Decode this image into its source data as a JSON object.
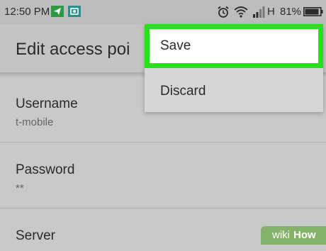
{
  "status_bar": {
    "time": "12:50 PM",
    "signal_label": "H",
    "battery": "81%",
    "icons": [
      "navigation-icon",
      "screenshot-icon",
      "alarm-icon",
      "wifi-icon",
      "signal-icon",
      "battery-icon"
    ]
  },
  "app_bar": {
    "title": "Edit access poi"
  },
  "prefs": [
    {
      "title": "Username",
      "summary": "t-mobile"
    },
    {
      "title": "Password",
      "summary": "**"
    },
    {
      "title": "Server",
      "summary": ""
    }
  ],
  "menu": {
    "save_label": "Save",
    "discard_label": "Discard"
  },
  "watermark": {
    "wiki": "wiki",
    "how": "How"
  },
  "colors": {
    "highlight": "#28e01c",
    "status_nav_icon": "#2e9a48",
    "watermark_bg": "#84b26a"
  }
}
